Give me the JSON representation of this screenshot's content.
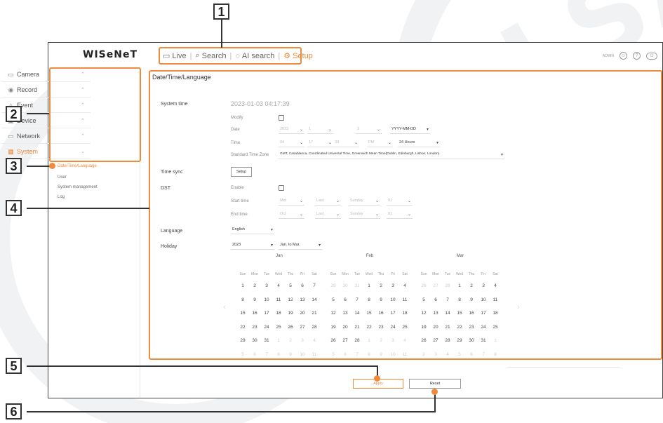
{
  "colors": {
    "accent": "#f08a3c",
    "border": "#444444",
    "watermark": "#f1f2f4"
  },
  "watermark": "COLLSA",
  "header": {
    "logo": "WISeNeT",
    "nav": [
      {
        "label": "Live",
        "icon": "monitor-icon"
      },
      {
        "label": "Search",
        "icon": "search-icon"
      },
      {
        "label": "AI search",
        "icon": "ai-search-icon"
      },
      {
        "label": "Setup",
        "icon": "gear-icon",
        "active": true
      }
    ],
    "user_label": "ADMIN",
    "icons": [
      "user-icon",
      "help-icon",
      "logout-icon"
    ]
  },
  "callouts": [
    "1",
    "2",
    "3",
    "4",
    "5",
    "6"
  ],
  "sidebar": {
    "items": [
      {
        "label": "Camera",
        "icon": "camera-icon"
      },
      {
        "label": "Record",
        "icon": "record-icon"
      },
      {
        "label": "Event",
        "icon": "bell-icon"
      },
      {
        "label": "Device",
        "icon": "device-icon"
      },
      {
        "label": "Network",
        "icon": "network-icon"
      },
      {
        "label": "System",
        "icon": "system-icon",
        "selected": true
      }
    ],
    "subitems": [
      {
        "label": "Date/Time/Language",
        "selected": true
      },
      {
        "label": "User"
      },
      {
        "label": "System management"
      },
      {
        "label": "Log"
      }
    ]
  },
  "content": {
    "title": "Date/Time/Language",
    "system_time": {
      "label": "System time",
      "value": "2023-01-03 04:17:39"
    },
    "modify": {
      "label": "Modify"
    },
    "date": {
      "label": "Date",
      "fields": [
        "2023",
        "1",
        "3"
      ],
      "format": "YYYY-MM-DD"
    },
    "time": {
      "label": "Time",
      "fields": [
        "04",
        "17",
        "39",
        "PM"
      ],
      "format": "24 Hours"
    },
    "timezone": {
      "label": "Standard Time Zone",
      "value": "GMT, Casablanca, Coordinated Universal Time, Greenwich Mean Time(Dublin, Edinburgh, Lisbon, London)"
    },
    "time_sync": {
      "label": "Time sync",
      "button": "Setup"
    },
    "dst": {
      "label": "DST",
      "enable": "Enable",
      "start_label": "Start time",
      "end_label": "End time",
      "start": [
        "Mar",
        "Last",
        "Sunday",
        "01"
      ],
      "end": [
        "Oct",
        "Last",
        "Sunday",
        "01"
      ]
    },
    "language": {
      "label": "Language",
      "value": "English"
    },
    "holiday": {
      "label": "Holiday",
      "year": "2023",
      "range": "Jan. to Mar."
    }
  },
  "calendars": [
    {
      "month": "Jan",
      "days": [
        "1",
        "2",
        "3",
        "4",
        "5",
        "6",
        "7",
        "8",
        "9",
        "10",
        "11",
        "12",
        "13",
        "14",
        "15",
        "16",
        "17",
        "18",
        "19",
        "20",
        "21",
        "22",
        "23",
        "24",
        "25",
        "26",
        "27",
        "28",
        "29",
        "30",
        "31",
        "1",
        "2",
        "3",
        "4",
        "5",
        "6",
        "7",
        "8",
        "9",
        "10",
        "11"
      ]
    },
    {
      "month": "Feb",
      "days": [
        "29",
        "30",
        "31",
        "1",
        "2",
        "3",
        "4",
        "5",
        "6",
        "7",
        "8",
        "9",
        "10",
        "11",
        "12",
        "13",
        "14",
        "15",
        "16",
        "17",
        "18",
        "19",
        "20",
        "21",
        "22",
        "23",
        "24",
        "25",
        "26",
        "27",
        "28",
        "1",
        "2",
        "3",
        "4",
        "5",
        "6",
        "7",
        "8",
        "9",
        "10",
        "11"
      ]
    },
    {
      "month": "Mar",
      "days": [
        "26",
        "27",
        "28",
        "1",
        "2",
        "3",
        "4",
        "5",
        "6",
        "7",
        "8",
        "9",
        "10",
        "11",
        "12",
        "13",
        "14",
        "15",
        "16",
        "17",
        "18",
        "19",
        "20",
        "21",
        "22",
        "23",
        "24",
        "25",
        "26",
        "27",
        "28",
        "29",
        "30",
        "31",
        "1",
        "2",
        "3",
        "4",
        "5",
        "6",
        "7",
        "8"
      ]
    }
  ],
  "weekdays": [
    "Sun",
    "Mon",
    "Tue",
    "Wed",
    "Thu",
    "Fri",
    "Sat"
  ],
  "footer": {
    "apply": "Apply",
    "reset": "Reset"
  }
}
